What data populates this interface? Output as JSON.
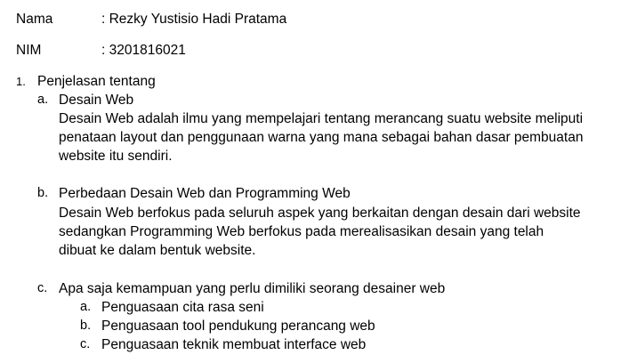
{
  "identity": {
    "nama_label": "Nama",
    "nama_value": ": Rezky Yustisio Hadi Pratama",
    "nim_label": "NIM",
    "nim_value": ": 3201816021"
  },
  "section1": {
    "number": "1.",
    "title": "Penjelasan tentang",
    "a": {
      "letter": "a.",
      "title": "Desain Web",
      "lines": [
        "Desain Web adalah ilmu yang mempelajari tentang merancang suatu website meliputi",
        "penataan layout dan penggunaan warna yang mana sebagai bahan dasar pembuatan",
        "website itu sendiri."
      ]
    },
    "b": {
      "letter": "b.",
      "title": "Perbedaan Desain Web dan Programming Web",
      "lines": [
        "Desain Web berfokus pada seluruh aspek yang berkaitan dengan desain dari website",
        "sedangkan Programming Web berfokus pada merealisasikan desain yang telah",
        "dibuat ke dalam bentuk website."
      ]
    },
    "c": {
      "letter": "c.",
      "title": "Apa saja kemampuan yang perlu dimiliki seorang desainer web",
      "items": [
        {
          "letter": "a.",
          "text": "Penguasaan cita rasa seni"
        },
        {
          "letter": "b.",
          "text": "Penguasaan tool pendukung perancang web"
        },
        {
          "letter": "c.",
          "text": "Penguasaan teknik membuat interface web"
        }
      ]
    }
  }
}
